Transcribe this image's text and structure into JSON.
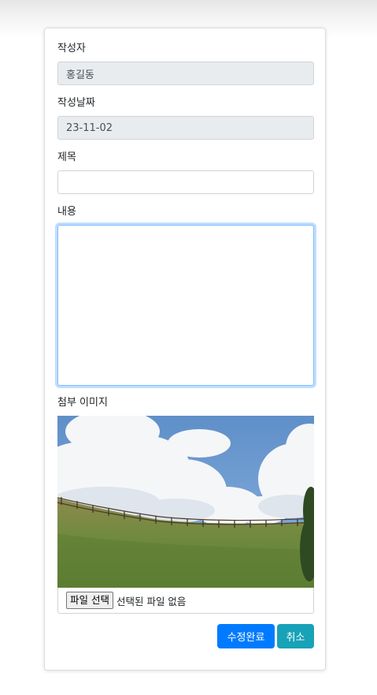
{
  "form": {
    "author_label": "작성자",
    "author_value": "홍길동",
    "date_label": "작성날짜",
    "date_value": "23-11-02",
    "title_label": "제목",
    "title_value": "",
    "content_label": "내용",
    "content_value": "",
    "image_label": "첨부 이미지",
    "file_button_label": "파일 선택",
    "file_status": "선택된 파일 없음"
  },
  "actions": {
    "submit_label": "수정완료",
    "cancel_label": "취소"
  },
  "colors": {
    "primary": "#007bff",
    "info": "#17a2b8",
    "readonly_bg": "#e9ecef",
    "focus_border": "#80bdff"
  }
}
